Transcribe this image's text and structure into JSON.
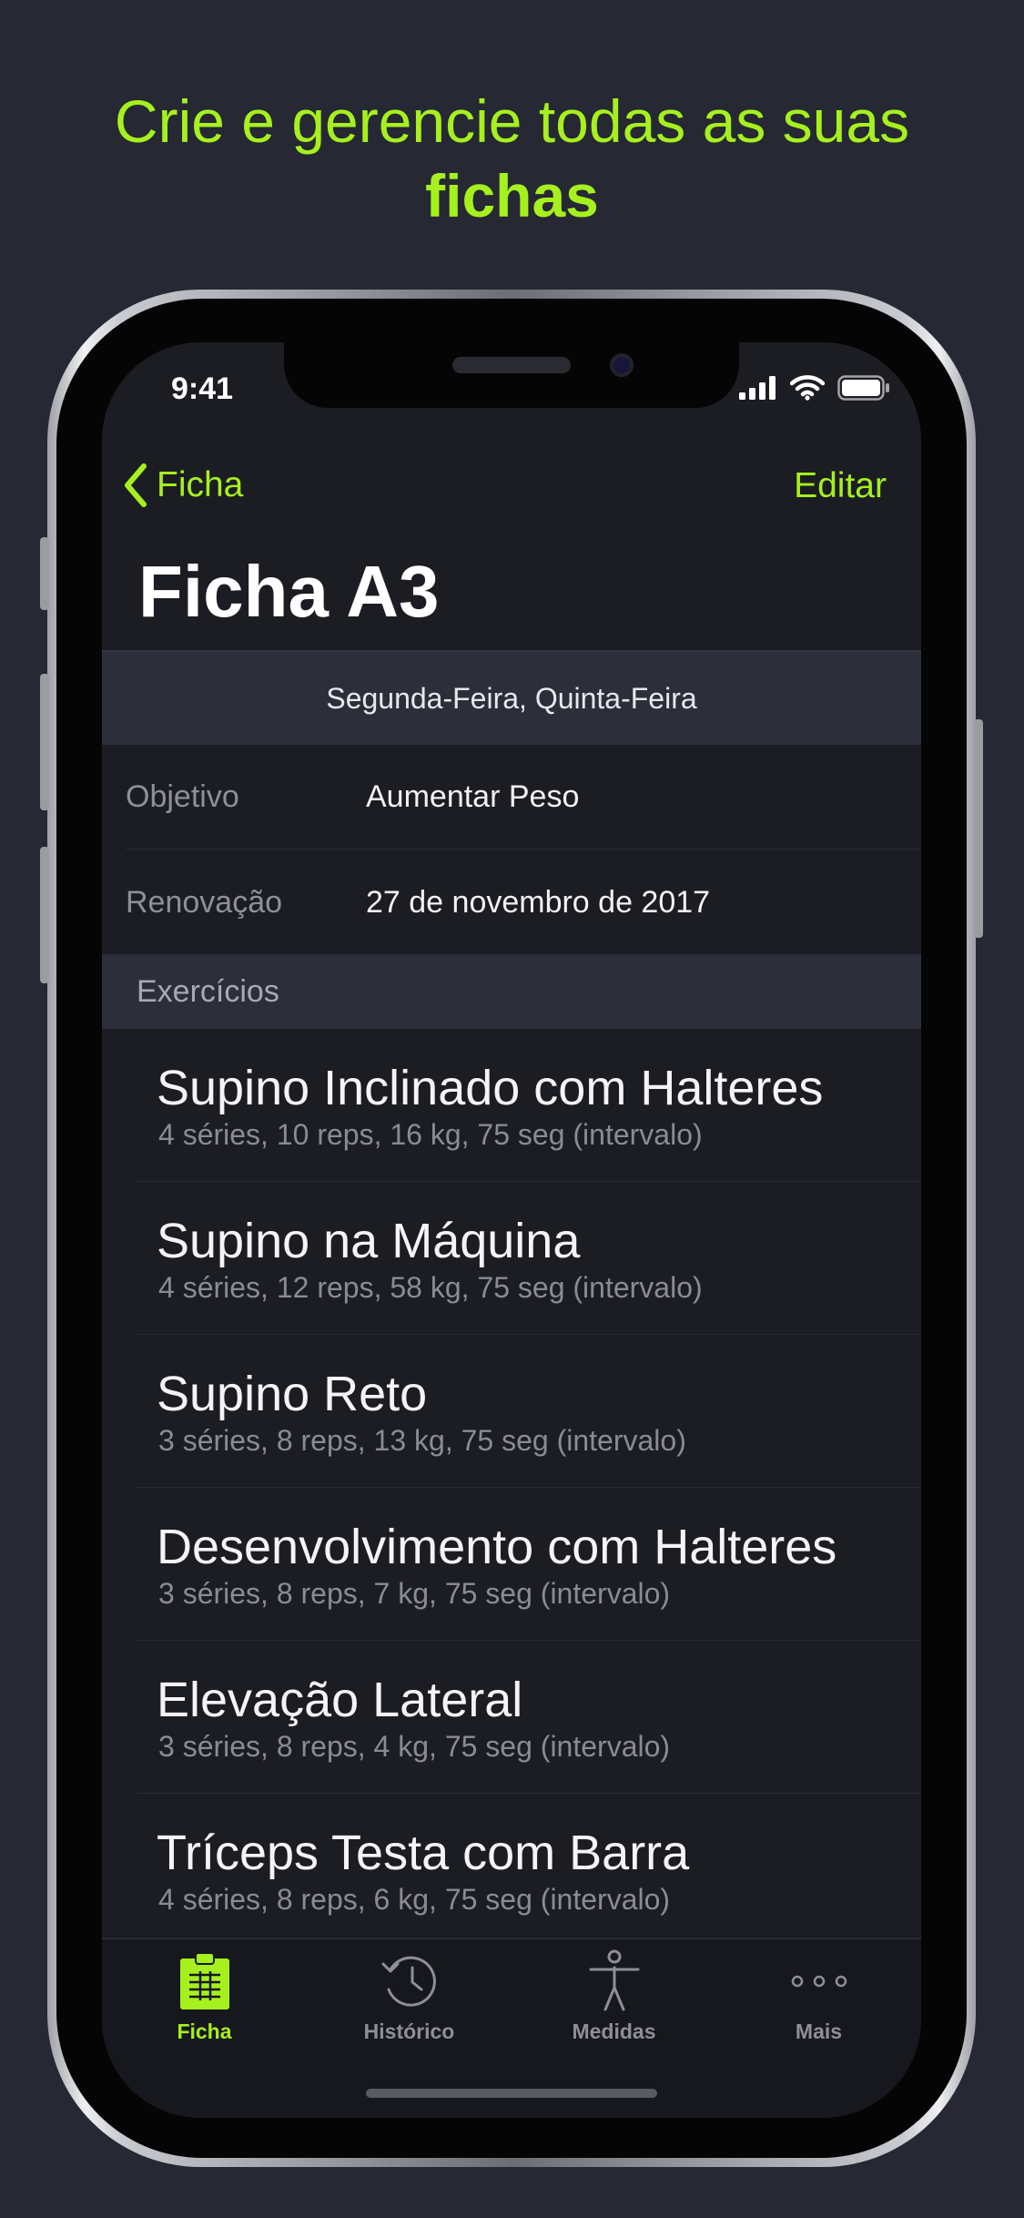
{
  "headline": {
    "line1": "Crie e gerencie todas as suas",
    "line2": "fichas"
  },
  "status": {
    "time": "9:41"
  },
  "nav": {
    "back_label": "Ficha",
    "edit_label": "Editar"
  },
  "title": "Ficha A3",
  "days": "Segunda-Feira, Quinta-Feira",
  "info": {
    "objective": {
      "label": "Objetivo",
      "value": "Aumentar Peso"
    },
    "renewal": {
      "label": "Renovação",
      "value": "27 de novembro de 2017"
    }
  },
  "exercises_header": "Exercícios",
  "exercises": [
    {
      "name": "Supino Inclinado com Halteres",
      "detail": "4 séries, 10 reps, 16 kg, 75 seg (intervalo)"
    },
    {
      "name": "Supino na Máquina",
      "detail": "4 séries, 12 reps, 58 kg, 75 seg (intervalo)"
    },
    {
      "name": "Supino Reto",
      "detail": "3 séries, 8 reps, 13 kg, 75 seg (intervalo)"
    },
    {
      "name": "Desenvolvimento com Halteres",
      "detail": "3 séries, 8 reps, 7 kg, 75 seg (intervalo)"
    },
    {
      "name": "Elevação Lateral",
      "detail": "3 séries, 8 reps, 4 kg, 75 seg (intervalo)"
    },
    {
      "name": "Tríceps Testa com Barra",
      "detail": "4 séries, 8 reps, 6 kg, 75 seg (intervalo)"
    }
  ],
  "tabs": [
    {
      "label": "Ficha",
      "icon": "clipboard-icon",
      "active": true
    },
    {
      "label": "Histórico",
      "icon": "history-clock-icon",
      "active": false
    },
    {
      "label": "Medidas",
      "icon": "body-figure-icon",
      "active": false
    },
    {
      "label": "Mais",
      "icon": "more-dots-icon",
      "active": false
    }
  ],
  "colors": {
    "accent": "#a6f01e",
    "background": "#262833",
    "screen": "#1c1d23",
    "band": "#2c2e3a"
  }
}
